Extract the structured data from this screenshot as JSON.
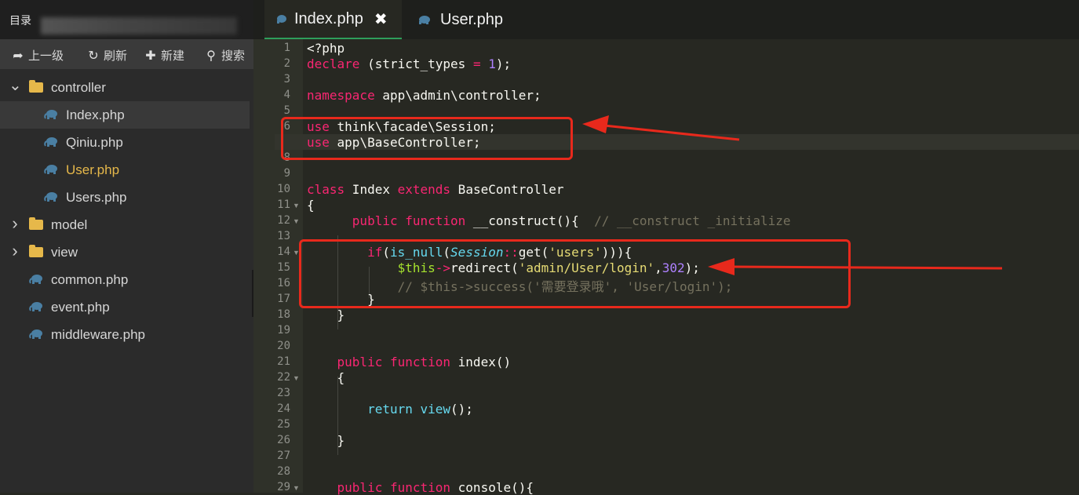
{
  "sidebar": {
    "title": "目录",
    "toolbar": [
      {
        "icon": "level-up-icon",
        "glyph": "➦",
        "label": "上一级"
      },
      {
        "icon": "refresh-icon",
        "glyph": "↻",
        "label": "刷新"
      },
      {
        "icon": "plus-icon",
        "glyph": "✚",
        "label": "新建"
      },
      {
        "icon": "search-icon",
        "glyph": "⚲",
        "label": "搜索"
      }
    ],
    "tree": [
      {
        "type": "folder",
        "label": "controller",
        "expanded": true,
        "depth": 0
      },
      {
        "type": "file",
        "label": "Index.php",
        "depth": 1,
        "active": true
      },
      {
        "type": "file",
        "label": "Qiniu.php",
        "depth": 1
      },
      {
        "type": "file",
        "label": "User.php",
        "depth": 1,
        "highlight": true
      },
      {
        "type": "file",
        "label": "Users.php",
        "depth": 1
      },
      {
        "type": "folder",
        "label": "model",
        "expanded": false,
        "depth": 0
      },
      {
        "type": "folder",
        "label": "view",
        "expanded": false,
        "depth": 0
      },
      {
        "type": "file",
        "label": "common.php",
        "depth": 0
      },
      {
        "type": "file",
        "label": "event.php",
        "depth": 0
      },
      {
        "type": "file",
        "label": "middleware.php",
        "depth": 0
      }
    ]
  },
  "tabs": [
    {
      "label": "Index.php",
      "active": true,
      "close": "✖"
    },
    {
      "label": "User.php",
      "active": false
    }
  ],
  "editor": {
    "lines": [
      {
        "n": "1",
        "text": "<?php"
      },
      {
        "n": "2",
        "text": "declare (strict_types = 1);"
      },
      {
        "n": "3",
        "text": ""
      },
      {
        "n": "4",
        "text": "namespace app\\admin\\controller;"
      },
      {
        "n": "5",
        "text": ""
      },
      {
        "n": "6",
        "text": "use think\\facade\\Session;"
      },
      {
        "n": "7",
        "text": "use app\\BaseController;"
      },
      {
        "n": "8",
        "text": ""
      },
      {
        "n": "9",
        "text": ""
      },
      {
        "n": "10",
        "text": "class Index extends BaseController"
      },
      {
        "n": "11",
        "text": "{",
        "fold": true
      },
      {
        "n": "12",
        "text": "      public function __construct(){  // __construct _initialize",
        "fold": true
      },
      {
        "n": "13",
        "text": ""
      },
      {
        "n": "14",
        "text": "        if(is_null(Session::get('users'))){",
        "fold": true
      },
      {
        "n": "15",
        "text": "            $this->redirect('admin/User/login',302);"
      },
      {
        "n": "16",
        "text": "            // $this->success('需要登录哦', 'User/login');"
      },
      {
        "n": "17",
        "text": "        }"
      },
      {
        "n": "18",
        "text": "    }"
      },
      {
        "n": "19",
        "text": ""
      },
      {
        "n": "20",
        "text": ""
      },
      {
        "n": "21",
        "text": "    public function index()"
      },
      {
        "n": "22",
        "text": "    {",
        "fold": true
      },
      {
        "n": "23",
        "text": ""
      },
      {
        "n": "24",
        "text": "        return view();"
      },
      {
        "n": "25",
        "text": ""
      },
      {
        "n": "26",
        "text": "    }"
      },
      {
        "n": "27",
        "text": ""
      },
      {
        "n": "28",
        "text": ""
      },
      {
        "n": "29",
        "text": "    public function console(){",
        "fold": true
      }
    ]
  },
  "colors": {
    "keyword": "#f92672",
    "number": "#ae81ff",
    "string": "#e6db74",
    "comment": "#75715e",
    "function": "#a6e22e",
    "annotation": "#e8291c",
    "tab_accent": "#2e9e5b"
  }
}
